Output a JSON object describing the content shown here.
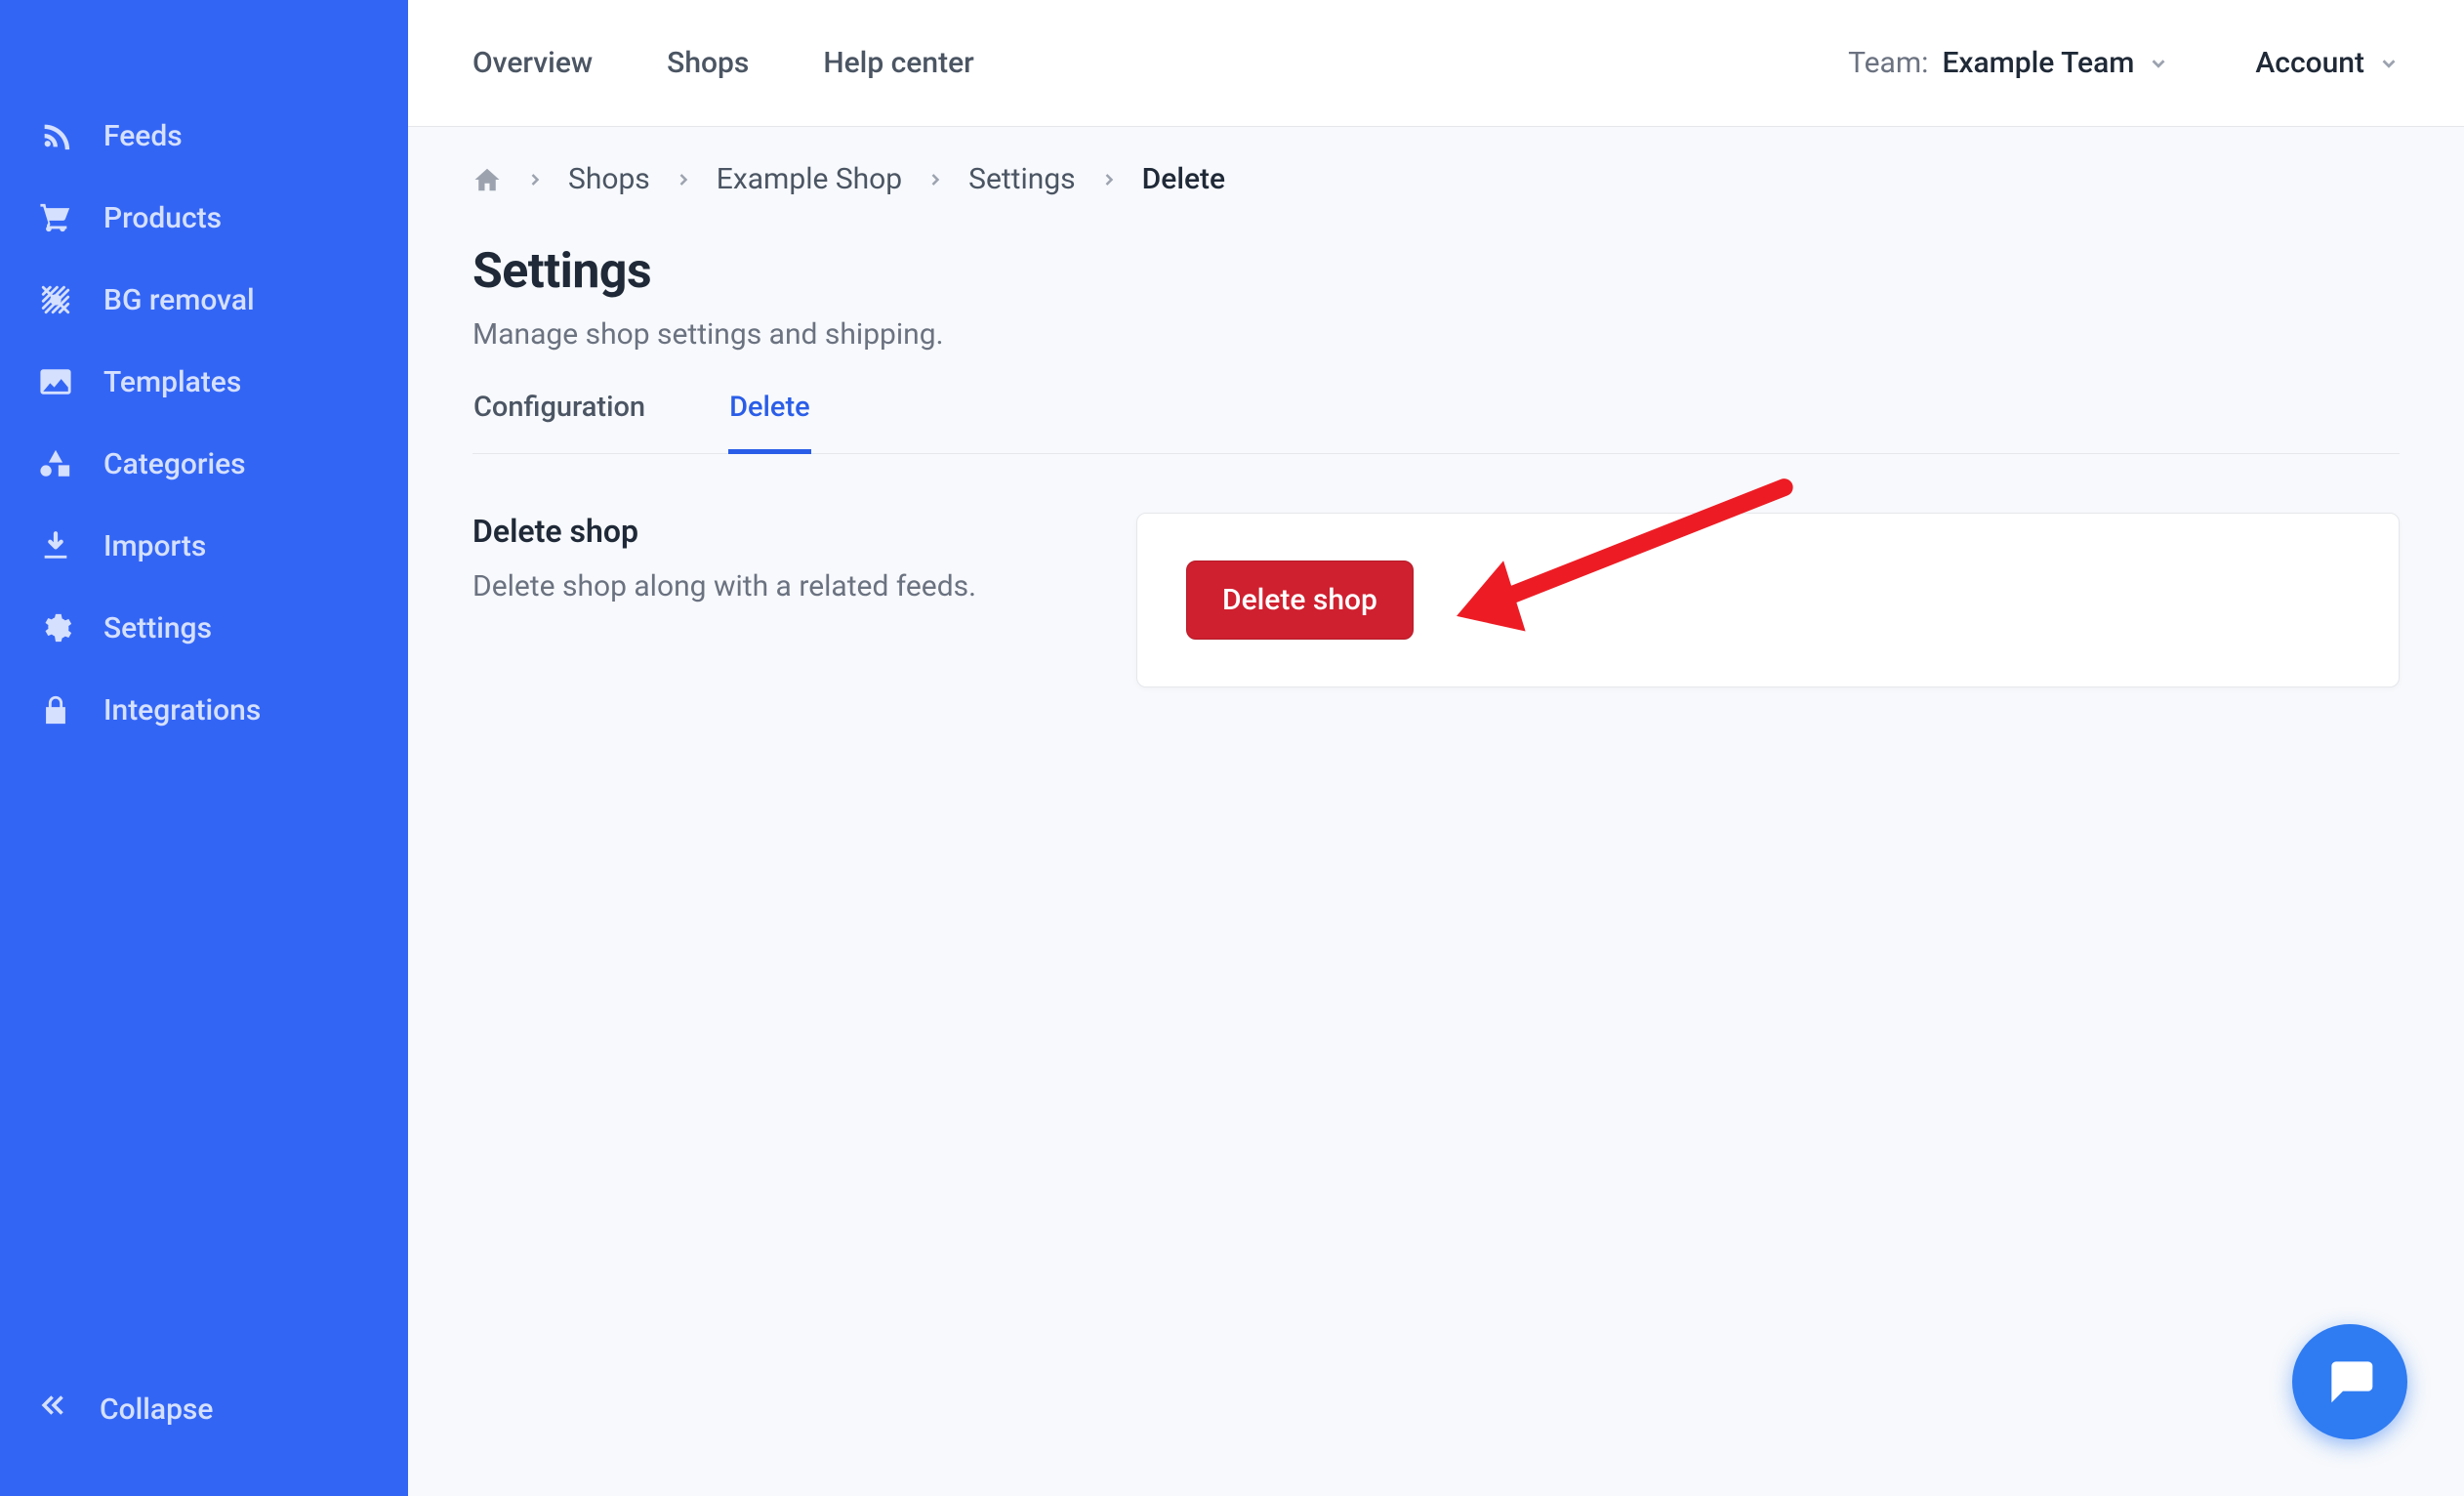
{
  "sidebar": {
    "items": [
      {
        "label": "Feeds",
        "icon": "rss-icon"
      },
      {
        "label": "Products",
        "icon": "cart-icon"
      },
      {
        "label": "BG removal",
        "icon": "bg-remove-icon"
      },
      {
        "label": "Templates",
        "icon": "image-icon"
      },
      {
        "label": "Categories",
        "icon": "shapes-icon"
      },
      {
        "label": "Imports",
        "icon": "download-icon"
      },
      {
        "label": "Settings",
        "icon": "gear-icon"
      },
      {
        "label": "Integrations",
        "icon": "lock-icon"
      }
    ],
    "collapse_label": "Collapse"
  },
  "topnav": {
    "items": [
      "Overview",
      "Shops",
      "Help center"
    ],
    "team_label": "Team:",
    "team_value": "Example Team",
    "account_label": "Account"
  },
  "breadcrumb": {
    "items": [
      "Shops",
      "Example Shop",
      "Settings",
      "Delete"
    ]
  },
  "page": {
    "title": "Settings",
    "subtitle": "Manage shop settings and shipping."
  },
  "tabs": {
    "items": [
      "Configuration",
      "Delete"
    ],
    "active_index": 1
  },
  "section": {
    "title": "Delete shop",
    "desc": "Delete shop along with a related feeds.",
    "button_label": "Delete shop"
  }
}
